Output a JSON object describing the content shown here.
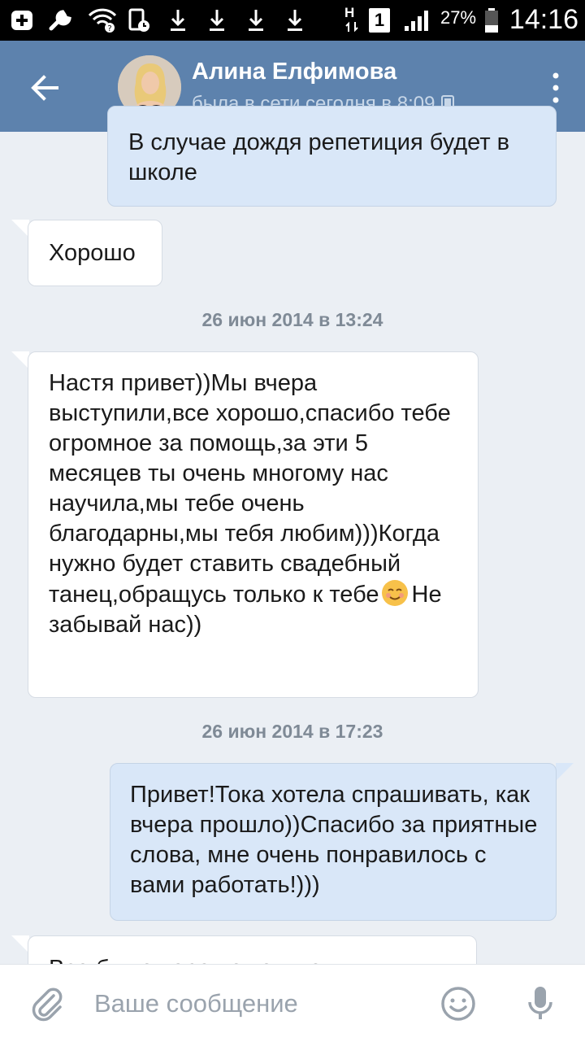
{
  "status_bar": {
    "battery_percent": "27%",
    "time": "14:16",
    "sim_label": "1",
    "net_label": "H"
  },
  "header": {
    "contact_name": "Алина Елфимова",
    "last_seen": "была в сети сегодня в 8:09"
  },
  "messages": [
    {
      "direction": "out",
      "text": "В случае дождя репетиция будет в школе"
    },
    {
      "direction": "in",
      "text": "Хорошо"
    },
    {
      "type": "date",
      "text": "26 июн 2014 в 13:24"
    },
    {
      "direction": "in",
      "text_before_emoji": "Настя привет))Мы вчера выступили,все хорошо,спасибо тебе огромное за помощь,за эти 5 месяцев ты очень многому нас научила,мы тебе очень благодарны,мы тебя любим)))Когда нужно будет ставить свадебный танец,обращусь только к тебе",
      "emoji": "smiling-face-icon",
      "text_after_emoji": "Не забывай нас))"
    },
    {
      "type": "date",
      "text": "26 июн 2014 в 17:23"
    },
    {
      "direction": "out",
      "text": "Привет!Тока хотела спрашивать, как вчера прошло))Спасибо за приятные слова, мне очень понравилось с вами работать!)))"
    },
    {
      "direction": "in",
      "text": "Все было хорошо только"
    }
  ],
  "compose": {
    "placeholder": "Ваше сообщение"
  },
  "colors": {
    "header_bg": "#5d82ad",
    "chat_bg": "#ebeff4",
    "outgoing_bubble": "#d9e7f8",
    "incoming_bubble": "#ffffff"
  }
}
